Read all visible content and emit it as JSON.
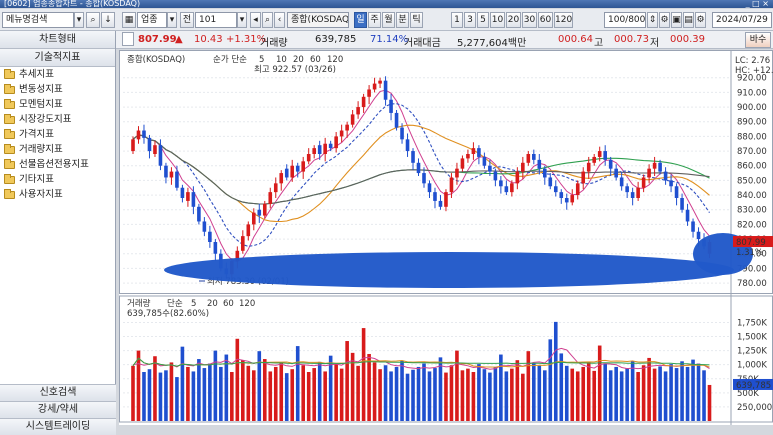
{
  "window": {
    "title": "[0602] 업종종합차트 - 종합(KOSDAQ)",
    "right_info": "_ □ ×"
  },
  "left_search": {
    "value": "메뉴명검색"
  },
  "toolbar": {
    "market": "업종",
    "code_prefix": "전",
    "code": "101",
    "market_name": "종합(KOSDAQ)",
    "period_buttons": [
      "일",
      "주",
      "월",
      "분",
      "틱"
    ],
    "period_selected": "일",
    "num_buttons": [
      "1",
      "3",
      "5",
      "10",
      "20",
      "30",
      "60",
      "120"
    ],
    "count": "100/800",
    "date": "2024/07/29"
  },
  "quote": {
    "price": "807.99",
    "change": "10.43",
    "change_pct": "+1.31%",
    "volume_label": "거래량",
    "volume": "639,785",
    "vol_ratio": "71.14%",
    "amount_label": "거래대금",
    "amount": "5,277,604백만",
    "open": "000.64",
    "high_label": "고",
    "high": "000.73",
    "low_label": "저",
    "low": "000.39",
    "mode_btn": "바수"
  },
  "sidebar": {
    "header": "차트형태",
    "section": "기술적지표",
    "items": [
      "추세지표",
      "변동성지표",
      "모멘텀지표",
      "시장강도지표",
      "가격지표",
      "거래량지표",
      "선물옵션전용지표",
      "기타지표",
      "사용자지표"
    ],
    "bottom_buttons": [
      "신호검색",
      "강세/약세",
      "시스템트레이딩"
    ]
  },
  "price_panel": {
    "legend_name": "종합(KOSDAQ)",
    "legend_ma": "순가 단순",
    "ma_periods": [
      "5",
      "10",
      "20",
      "60",
      "120"
    ],
    "ma_colors": [
      "#d04090",
      "#3050c0",
      "#e09020",
      "#30a050",
      "#606060"
    ],
    "high_note": "최고 922.57 (03/26)",
    "low_note": "최저 783.30 (02/01)",
    "right_top": "LC: 2.76",
    "right_top2": "HC: +12.42",
    "current_tag": "807.99",
    "current_pct": "1.31%",
    "y_ticks": [
      "920.00",
      "910.00",
      "900.00",
      "890.00",
      "880.00",
      "870.00",
      "860.00",
      "850.00",
      "840.00",
      "830.00",
      "820.00",
      "810.00",
      "800.00",
      "790.00",
      "780.00"
    ]
  },
  "volume_panel": {
    "legend_name": "거래량",
    "legend_ma": "단순",
    "ma_periods": [
      "5",
      "20",
      "60",
      "120"
    ],
    "sub_legend": "639,785수(82.60%)",
    "current_tag": "639,785",
    "y_ticks": [
      "1,750K",
      "1,500K",
      "1,250K",
      "1,000K",
      "750K",
      "500K",
      "250,000"
    ]
  },
  "chart_data": {
    "type": "candlestick",
    "price": {
      "ylim": [
        778,
        928
      ],
      "close": [
        878,
        884,
        879,
        870,
        874,
        860,
        852,
        856,
        845,
        838,
        842,
        832,
        822,
        815,
        808,
        800,
        790,
        786,
        795,
        802,
        812,
        820,
        828,
        826,
        834,
        842,
        848,
        855,
        852,
        860,
        856,
        863,
        868,
        872,
        868,
        875,
        872,
        880,
        884,
        888,
        895,
        900,
        907,
        912,
        916,
        918,
        905,
        896,
        886,
        878,
        870,
        862,
        855,
        848,
        842,
        836,
        832,
        842,
        852,
        858,
        865,
        868,
        872,
        866,
        860,
        856,
        850,
        846,
        842,
        848,
        856,
        862,
        868,
        864,
        858,
        852,
        846,
        842,
        838,
        835,
        840,
        848,
        856,
        862,
        866,
        870,
        864,
        858,
        852,
        846,
        842,
        838,
        845,
        852,
        858,
        862,
        856,
        850,
        846,
        838,
        830,
        822,
        815,
        810,
        805,
        808
      ],
      "open": [
        870,
        878,
        884,
        879,
        868,
        874,
        860,
        852,
        856,
        845,
        836,
        842,
        832,
        822,
        815,
        808,
        800,
        790,
        786,
        795,
        802,
        812,
        820,
        830,
        826,
        834,
        842,
        848,
        858,
        852,
        860,
        856,
        863,
        868,
        874,
        868,
        875,
        872,
        880,
        884,
        888,
        895,
        900,
        907,
        912,
        916,
        918,
        905,
        896,
        886,
        878,
        870,
        862,
        855,
        848,
        842,
        836,
        832,
        842,
        852,
        858,
        865,
        868,
        872,
        866,
        860,
        856,
        850,
        846,
        842,
        848,
        856,
        862,
        868,
        864,
        858,
        852,
        846,
        842,
        838,
        835,
        840,
        848,
        856,
        862,
        866,
        870,
        864,
        858,
        852,
        846,
        842,
        838,
        845,
        852,
        858,
        862,
        856,
        850,
        846,
        838,
        830,
        822,
        815,
        810,
        800
      ]
    },
    "volume": {
      "ylim": [
        0,
        1900
      ],
      "values": [
        980,
        1250,
        870,
        920,
        1150,
        860,
        900,
        1040,
        780,
        1320,
        960,
        880,
        1100,
        940,
        1020,
        1250,
        960,
        1180,
        870,
        1460,
        1080,
        980,
        900,
        1240,
        1100,
        880,
        960,
        1040,
        850,
        920,
        1330,
        990,
        870,
        940,
        1050,
        880,
        1160,
        1010,
        930,
        1420,
        1210,
        980,
        1650,
        1190,
        1040,
        920,
        990,
        880,
        960,
        1070,
        840,
        910,
        960,
        1020,
        880,
        940,
        1130,
        860,
        990,
        1250,
        900,
        930,
        870,
        1010,
        920,
        860,
        960,
        1180,
        880,
        930,
        1080,
        840,
        1240,
        1020,
        980,
        900,
        1450,
        1760,
        1200,
        980,
        930,
        880,
        960,
        1050,
        890,
        1340,
        1020,
        900,
        960,
        880,
        940,
        1060,
        870,
        990,
        1120,
        930,
        970,
        880,
        1010,
        940,
        1060,
        960,
        1090,
        1020,
        900,
        640
      ],
      "ma5": [
        1000,
        1020,
        990,
        1010,
        1030,
        980,
        990,
        1000,
        960,
        1020,
        990,
        980,
        1030,
        1000,
        1010,
        1050,
        1040,
        1080,
        1020,
        1100,
        1080,
        1060,
        1020,
        1050,
        1030,
        1000,
        990,
        1010,
        980,
        970,
        1010,
        1000,
        990,
        980,
        1000,
        980,
        1000,
        1010,
        990,
        1050,
        1070,
        1050,
        1120,
        1130,
        1110,
        1060,
        1050,
        1000,
        980,
        980,
        950,
        940,
        930,
        950,
        940,
        950,
        980,
        960,
        970,
        1020,
        1000,
        980,
        950,
        960,
        940,
        920,
        930,
        980,
        980,
        990,
        1000,
        970,
        1010,
        1040,
        1050,
        1030,
        1120,
        1260,
        1290,
        1260,
        1150,
        1040,
        990,
        960,
        940,
        1000,
        1020,
        1010,
        1000,
        950,
        930,
        940,
        930,
        940,
        970,
        980,
        990,
        980,
        980,
        970,
        980,
        990,
        1000,
        1010,
        990,
        930
      ]
    }
  }
}
